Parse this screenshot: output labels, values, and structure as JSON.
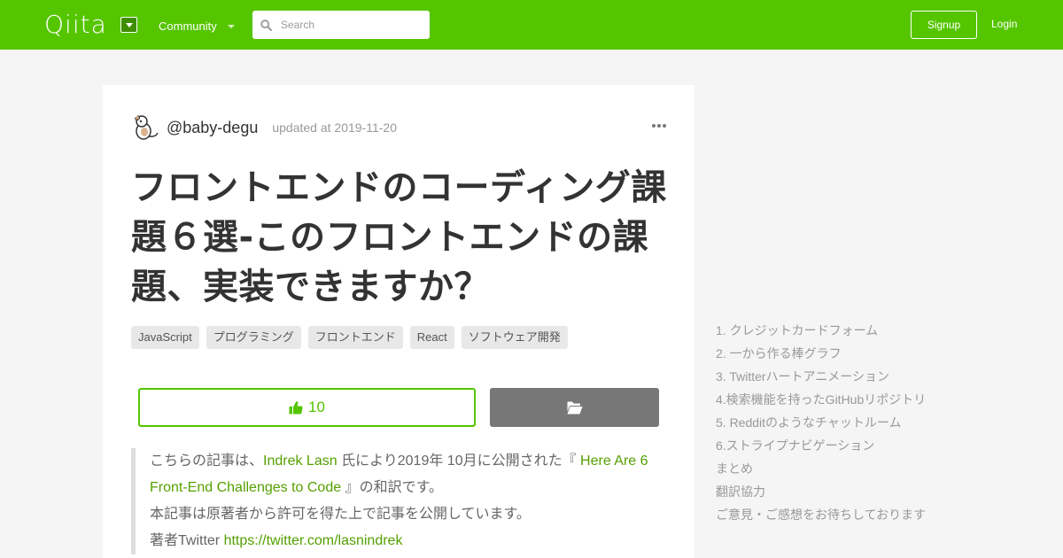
{
  "header": {
    "logo_text": "Qiita",
    "community_label": "Community",
    "search_placeholder": "Search",
    "signup_label": "Signup",
    "login_label": "Login"
  },
  "article": {
    "author": "@baby-degu",
    "updated": "updated at 2019-11-20",
    "title": "フロントエンドのコーディング課題６選-このフロントエンドの課題、実装できますか？",
    "tags": [
      "JavaScript",
      "プログラミング",
      "フロントエンド",
      "React",
      "ソフトウェア開発"
    ],
    "likes": "10",
    "quote": {
      "p1_prefix": "こちらの記事は、",
      "p1_author": "Indrek Lasn",
      "p1_mid": " 氏により2019年 10月に公開された『 ",
      "p1_link": "Here Are 6 Front-End Challenges to Code",
      "p1_suffix": " 』の和訳です。",
      "p2": "本記事は原著者から許可を得た上で記事を公開しています。",
      "p3_prefix": "著者Twitter ",
      "p3_link": "https://twitter.com/lasnindrek"
    }
  },
  "toc": [
    "1. クレジットカードフォーム",
    "2. 一から作る棒グラフ",
    "3. Twitterハートアニメーション",
    "4.検索機能を持ったGitHubリポジトリ",
    "5. Redditのようなチャットルーム",
    "6.ストライプナビゲーション",
    "まとめ",
    "翻訳協力",
    "ご意見・ご感想をお待ちしております"
  ],
  "colors": {
    "brand": "#55c500",
    "background": "#f5f5f5",
    "stock_button": "#777777"
  }
}
